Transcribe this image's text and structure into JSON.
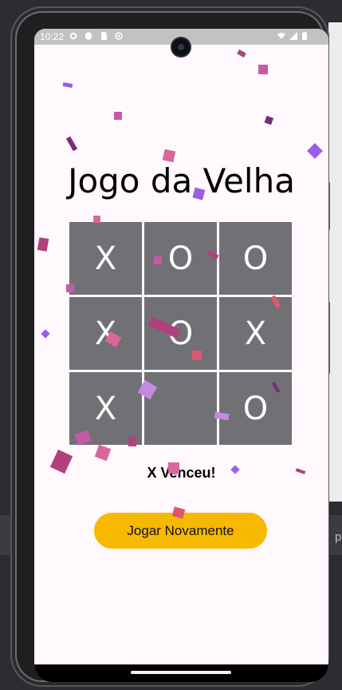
{
  "status_bar": {
    "time": "10:22",
    "left_icons": [
      "settings-icon",
      "shield-icon",
      "sim-icon",
      "location-icon"
    ],
    "right_icons": [
      "wifi-icon",
      "signal-icon",
      "battery-icon"
    ]
  },
  "game": {
    "title": "Jogo da Velha",
    "board": [
      [
        "X",
        "O",
        "O"
      ],
      [
        "X",
        "O",
        "X"
      ],
      [
        "X",
        "",
        "O"
      ]
    ],
    "result": "X Venceu!",
    "play_again_label": "Jogar Novamente"
  },
  "backdrop": {
    "edge_letter": "p"
  },
  "colors": {
    "accent": "#f6b900",
    "cell": "#707075",
    "screen_bg": "#fff8fd",
    "confetti": [
      "#b0417a",
      "#9b5de5",
      "#d9679c",
      "#c45aa8",
      "#7a2c78",
      "#e0566f"
    ]
  }
}
